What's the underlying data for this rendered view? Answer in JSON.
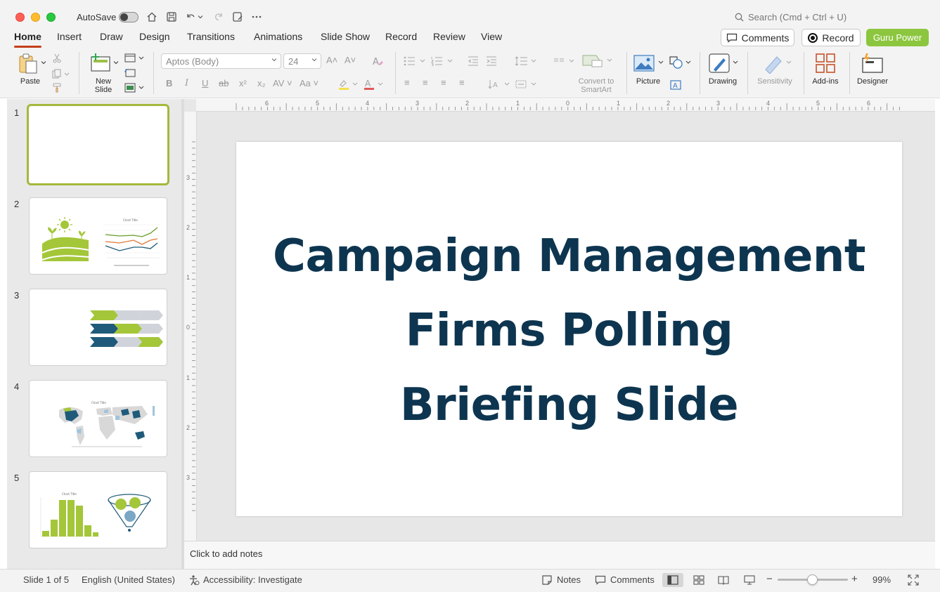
{
  "titlebar": {
    "autosave_label": "AutoSave",
    "search_placeholder": "Search (Cmd + Ctrl + U)"
  },
  "tabs": [
    {
      "label": "Home",
      "active": true
    },
    {
      "label": "Insert"
    },
    {
      "label": "Draw"
    },
    {
      "label": "Design"
    },
    {
      "label": "Transitions"
    },
    {
      "label": "Animations"
    },
    {
      "label": "Slide Show"
    },
    {
      "label": "Record"
    },
    {
      "label": "Review"
    },
    {
      "label": "View"
    }
  ],
  "header_buttons": {
    "comments": "Comments",
    "record": "Record",
    "guru": "Guru Power"
  },
  "ribbon": {
    "paste": "Paste",
    "new_slide_line1": "New",
    "new_slide_line2": "Slide",
    "font_name": "Aptos (Body)",
    "font_size": "24",
    "convert_line1": "Convert to",
    "convert_line2": "SmartArt",
    "picture": "Picture",
    "drawing": "Drawing",
    "sensitivity": "Sensitivity",
    "addins": "Add-ins",
    "designer": "Designer"
  },
  "thumbnails": [
    {
      "number": "1"
    },
    {
      "number": "2"
    },
    {
      "number": "3"
    },
    {
      "number": "4"
    },
    {
      "number": "5"
    }
  ],
  "ruler": {
    "h_labels": [
      "6",
      "5",
      "4",
      "3",
      "2",
      "1",
      "0",
      "1",
      "2",
      "3",
      "4",
      "5",
      "6"
    ],
    "v_labels": [
      "3",
      "2",
      "1",
      "0",
      "1",
      "2",
      "3"
    ]
  },
  "slide": {
    "title_line1": "Campaign Management",
    "title_line2": "Firms Polling",
    "title_line3": "Briefing Slide",
    "title_color": "#0d3550"
  },
  "notes": {
    "placeholder": "Click to add notes"
  },
  "status": {
    "slide_counter": "Slide 1 of 5",
    "language": "English (United States)",
    "accessibility": "Accessibility: Investigate",
    "notes": "Notes",
    "comments": "Comments",
    "zoom": "99%"
  },
  "colors": {
    "accent_green": "#8cc63f",
    "thumb_green": "#a4c639",
    "thumb_blue": "#1f5a7a",
    "thumb_gray": "#d0d4da"
  }
}
